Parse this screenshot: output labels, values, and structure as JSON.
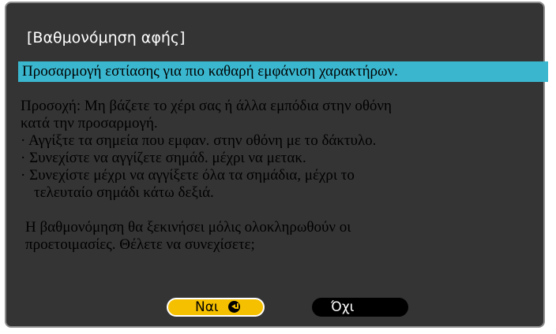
{
  "dialog": {
    "title": "[Βαθμονόμηση αφής]",
    "highlight": "Προσαρμογή εστίασης για πιο καθαρή εμφάνιση χαρακτήρων.",
    "warning_line1": "Προσοχή: Μη βάζετε το χέρι σας ή άλλα εμπόδια στην οθόνη",
    "warning_line2": "κατά την προσαρμογή.",
    "bullet1": "· Αγγίξτε τα σημεία που εμφαν. στην οθόνη με το δάκτυλο.",
    "bullet2": "· Συνεχίστε να αγγίζετε σημάδ. μέχρι να μετακ.",
    "bullet3_line1": "· Συνεχίστε μέχρι να αγγίξετε όλα τα σημάδια, μέχρι το",
    "bullet3_line2": "τελευταίο σημάδι κάτω δεξιά.",
    "question_line1": "Η βαθμονόμηση θα ξεκινήσει μόλις ολοκληρωθούν οι",
    "question_line2": "προετοιμασίες. Θέλετε να συνεχίσετε;"
  },
  "buttons": {
    "yes_label": "Ναι",
    "yes_icon": "enter-icon",
    "no_label": "Όχι"
  },
  "colors": {
    "panel_background": "#343434",
    "highlight_background": "#3ab7cf",
    "yes_button": "#f5c000",
    "no_button": "#000000"
  }
}
